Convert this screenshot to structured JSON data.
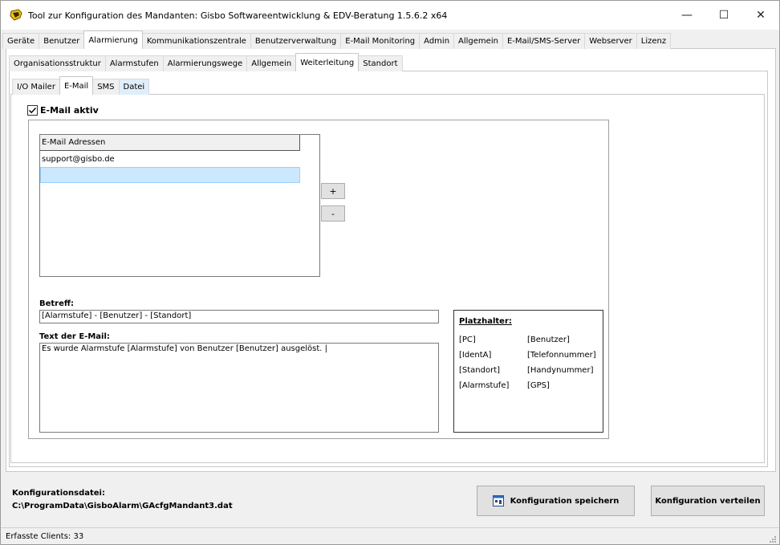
{
  "window": {
    "title": "Tool zur Konfiguration des Mandanten: Gisbo Softwareentwicklung & EDV-Beratung 1.5.6.2 x64",
    "controls": {
      "minimize": "—",
      "maximize": "☐",
      "close": "✕"
    }
  },
  "tabs_main": [
    {
      "label": "Geräte"
    },
    {
      "label": "Benutzer"
    },
    {
      "label": "Alarmierung",
      "active": true
    },
    {
      "label": "Kommunikationszentrale"
    },
    {
      "label": "Benutzerverwaltung"
    },
    {
      "label": "E-Mail Monitoring"
    },
    {
      "label": "Admin"
    },
    {
      "label": "Allgemein"
    },
    {
      "label": "E-Mail/SMS-Server"
    },
    {
      "label": "Webserver"
    },
    {
      "label": "Lizenz"
    }
  ],
  "tabs_sub": [
    {
      "label": "Organisationsstruktur"
    },
    {
      "label": "Alarmstufen"
    },
    {
      "label": "Alarmierungswege"
    },
    {
      "label": "Allgemein"
    },
    {
      "label": "Weiterleitung",
      "active": true
    },
    {
      "label": "Standort"
    }
  ],
  "tabs_sub2": [
    {
      "label": "I/O Mailer"
    },
    {
      "label": "E-Mail",
      "active": true
    },
    {
      "label": "SMS"
    },
    {
      "label": "Datei",
      "highlight": true
    }
  ],
  "email": {
    "enabled_label": "E-Mail aktiv",
    "enabled": true,
    "list_header": "E-Mail Adressen",
    "addresses": [
      "support@gisbo.de",
      ""
    ],
    "add_label": "+",
    "remove_label": "-",
    "subject_label": "Betreff:",
    "subject_value": "[Alarmstufe] - [Benutzer] - [Standort]",
    "body_label": "Text der E-Mail:",
    "body_value": "Es wurde Alarmstufe [Alarmstufe] von Benutzer [Benutzer] ausgelöst. |"
  },
  "placeholders": {
    "title": "Platzhalter:",
    "left": [
      "[PC]",
      "[IdentA]",
      "[Standort]",
      "[Alarmstufe]"
    ],
    "right": [
      "[Benutzer]",
      "[Telefonnummer]",
      "[Handynummer]",
      "[GPS]"
    ]
  },
  "footer": {
    "config_label": "Konfigurationsdatei:",
    "config_path": "C:\\ProgramData\\GisboAlarm\\GAcfgMandant3.dat",
    "save_button": "Konfiguration speichern",
    "distribute_button": "Konfiguration verteilen"
  },
  "status": {
    "text": "Erfasste Clients: 33"
  },
  "colors": {
    "selection": "#cce8ff",
    "tab_highlight": "#dfeefa",
    "window_bg": "#f0f0f0"
  }
}
